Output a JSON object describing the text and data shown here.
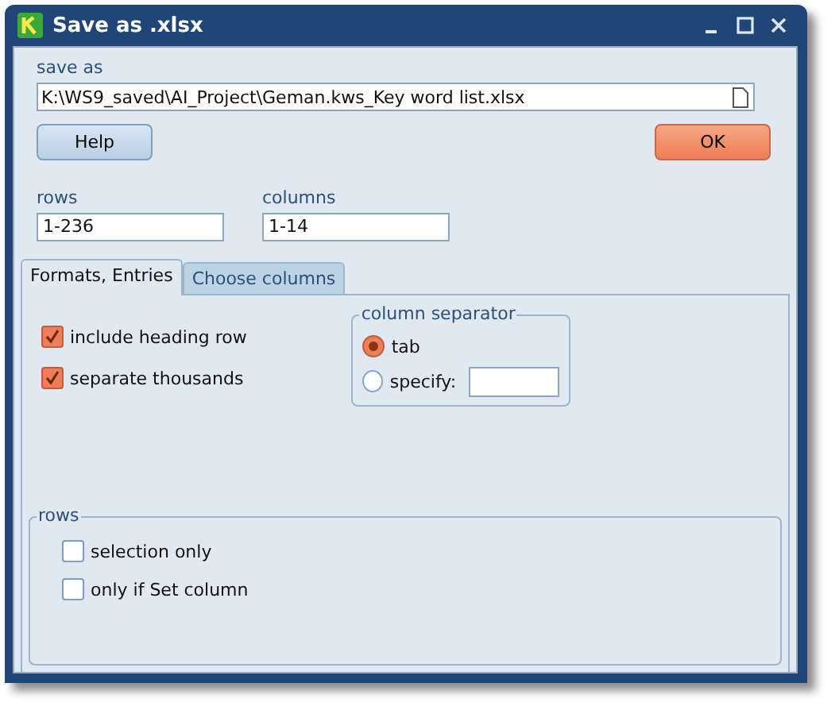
{
  "window": {
    "title": "Save as .xlsx"
  },
  "save_as": {
    "label": "save as",
    "value": "K:\\WS9_saved\\AI_Project\\Geman.kws_Key word list.xlsx"
  },
  "buttons": [
    {
      "label": "Help",
      "kind": "plain"
    },
    {
      "label": "OK",
      "kind": "default"
    }
  ],
  "ranges": [
    {
      "label": "rows",
      "value": "1-236"
    },
    {
      "label": "columns",
      "value": "1-14"
    }
  ],
  "tabs": [
    {
      "label": "Formats, Entries",
      "selected": true
    },
    {
      "label": "Choose columns",
      "selected": false
    }
  ],
  "options": [
    {
      "label": "include heading row",
      "checked": true
    },
    {
      "label": "separate thousands",
      "checked": true
    }
  ],
  "column_separator": {
    "title": "column separator",
    "choices": [
      {
        "label": "tab",
        "selected": true
      },
      {
        "label": "specify:",
        "selected": false
      }
    ]
  },
  "rows_group": {
    "title": "rows",
    "options": [
      {
        "label": "selection only",
        "checked": false
      },
      {
        "label": "only if Set column",
        "checked": false
      }
    ]
  }
}
